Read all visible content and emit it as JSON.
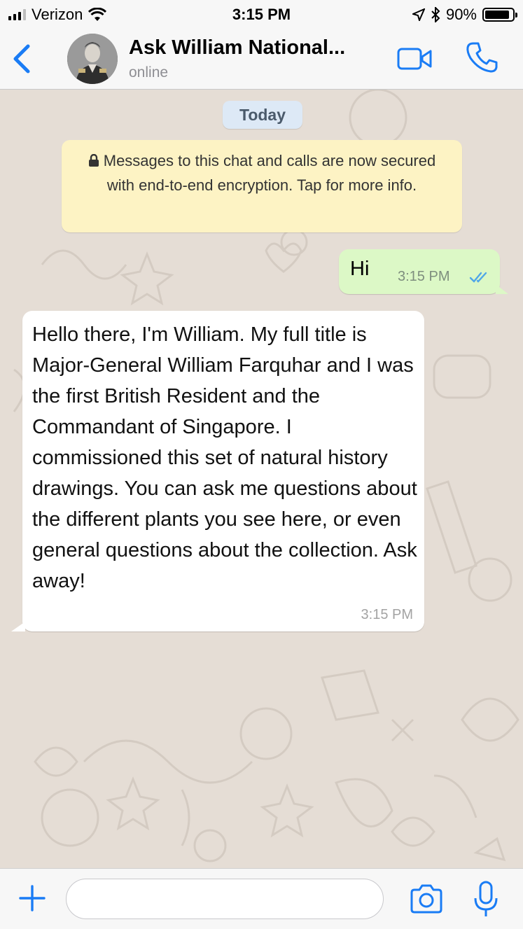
{
  "status_bar": {
    "carrier": "Verizon",
    "time": "3:15 PM",
    "battery_percent": "90%",
    "battery_level": 0.9
  },
  "header": {
    "back_icon": "chevron-left-icon",
    "title": "Ask William National...",
    "subtitle": "online",
    "video_icon": "video-camera-icon",
    "phone_icon": "phone-icon"
  },
  "chat": {
    "date_label": "Today",
    "encryption_notice": "Messages to this chat and calls are now secured with end-to-end encryption. Tap for more info.",
    "messages": [
      {
        "direction": "outgoing",
        "text": "Hi",
        "time": "3:15 PM",
        "status": "read"
      },
      {
        "direction": "incoming",
        "text": "Hello there, I'm William. My full title is Major-General William Farquhar and I was the first British Resident and the Commandant of Singapore. I commissioned this set of natural history drawings. You can ask me questions about the different plants you see here, or even general questions about the collection. Ask away!",
        "time": "3:15 PM"
      }
    ]
  },
  "input_bar": {
    "value": "",
    "placeholder": "",
    "plus_icon": "plus-icon",
    "camera_icon": "camera-icon",
    "mic_icon": "microphone-icon"
  },
  "colors": {
    "accent": "#1a7cf5",
    "chat_background": "#e5ddd5",
    "outgoing_bubble": "#dcf8c6",
    "incoming_bubble": "#ffffff",
    "notice_background": "#fdf3c4",
    "read_ticks": "#4fa6e8"
  }
}
